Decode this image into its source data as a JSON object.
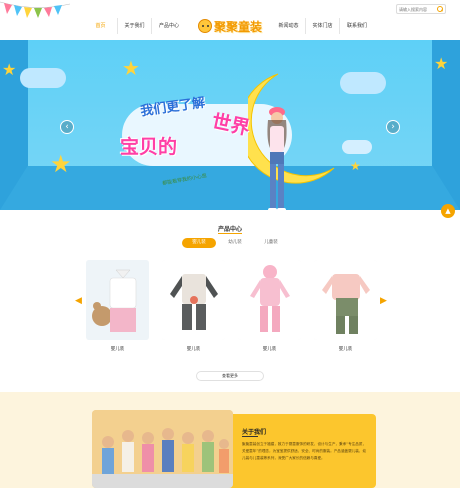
{
  "header": {
    "nav_left": [
      "首页",
      "关于我们",
      "产品中心"
    ],
    "nav_right": [
      "新闻动态",
      "实体门店",
      "联系我们"
    ],
    "active_nav": "首页",
    "logo_text": "聚聚童装",
    "search_placeholder": "请输入搜索内容"
  },
  "banner": {
    "slogan_top": "我们更了解",
    "slogan_main_left": "宝贝的",
    "slogan_main_right": "世界",
    "slogan_sub": "都能看穿我的小心思",
    "prev_label": "‹",
    "next_label": "›"
  },
  "products": {
    "title": "产品中心",
    "tabs": [
      "婴儿装",
      "幼儿装",
      "儿童装"
    ],
    "active_tab": "婴儿装",
    "items": [
      {
        "name": "婴儿装"
      },
      {
        "name": "婴儿装"
      },
      {
        "name": "婴儿装"
      },
      {
        "name": "婴儿装"
      }
    ],
    "more_label": "查看更多"
  },
  "about": {
    "title": "关于我们",
    "text": "聚聚童装创立于福建，致力于婴童服饰的研发、设计与生产，秉承“专注品质，关爱童年”的理念，为宝宝提供舒适、安全、时尚的服装。产品涵盖婴儿装、幼儿装与儿童装等系列，深受广大家长的信赖与喜爱。"
  },
  "colors": {
    "accent": "#f5a400",
    "banner_blue": "#3fb2ea",
    "about_yellow": "#fcc62d"
  }
}
